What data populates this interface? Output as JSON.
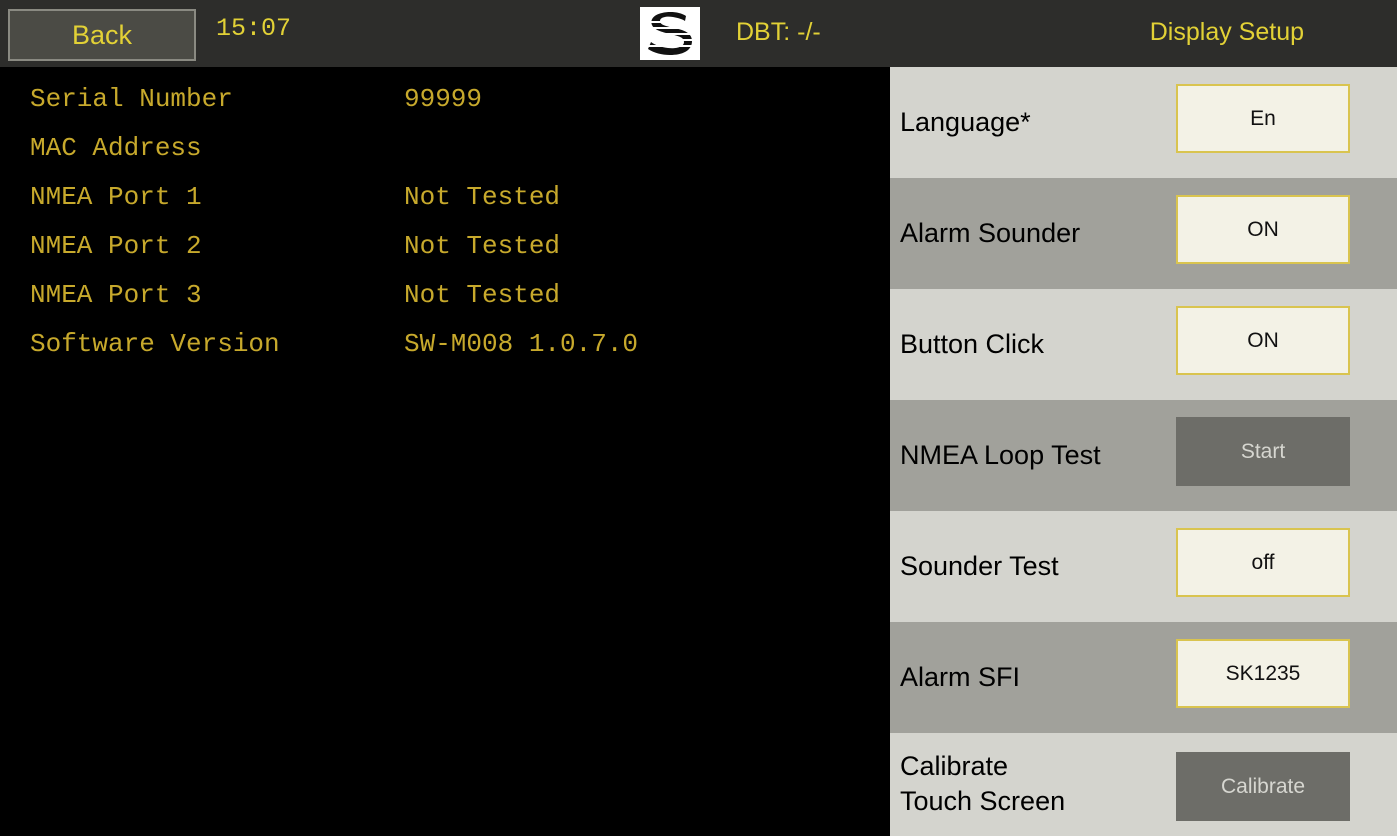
{
  "topbar": {
    "back_label": "Back",
    "clock": "15:07",
    "logo_letter": "S",
    "dbt": "DBT: -/-",
    "title": "Display Setup"
  },
  "info": {
    "rows": [
      {
        "label": "Serial Number",
        "value": "99999"
      },
      {
        "label": "MAC Address",
        "value": ""
      },
      {
        "label": "NMEA Port 1",
        "value": "Not Tested"
      },
      {
        "label": "NMEA Port 2",
        "value": "Not Tested"
      },
      {
        "label": "NMEA Port 3",
        "value": "Not Tested"
      },
      {
        "label": "Software Version",
        "value": "SW-M008 1.0.7.0"
      }
    ]
  },
  "settings": {
    "language": {
      "label": "Language*",
      "value": "En"
    },
    "alarm_sounder": {
      "label": "Alarm Sounder",
      "value": "ON"
    },
    "button_click": {
      "label": "Button Click",
      "value": "ON"
    },
    "nmea_loop_test": {
      "label": "NMEA Loop Test",
      "value": "Start"
    },
    "sounder_test": {
      "label": "Sounder Test",
      "value": "off"
    },
    "alarm_sfi": {
      "label": "Alarm SFI",
      "value": "SK1235"
    },
    "calibrate": {
      "label_line1": "Calibrate",
      "label_line2": "Touch Screen",
      "value": "Calibrate"
    }
  },
  "colors": {
    "accent_yellow": "#e2d136",
    "info_text": "#c7a92c",
    "topbar_bg": "#2d2d2b",
    "panel_light": "#d4d4ce",
    "panel_dark": "#a1a19b"
  },
  "icons": {
    "logo": "brand-s-logo-icon"
  }
}
